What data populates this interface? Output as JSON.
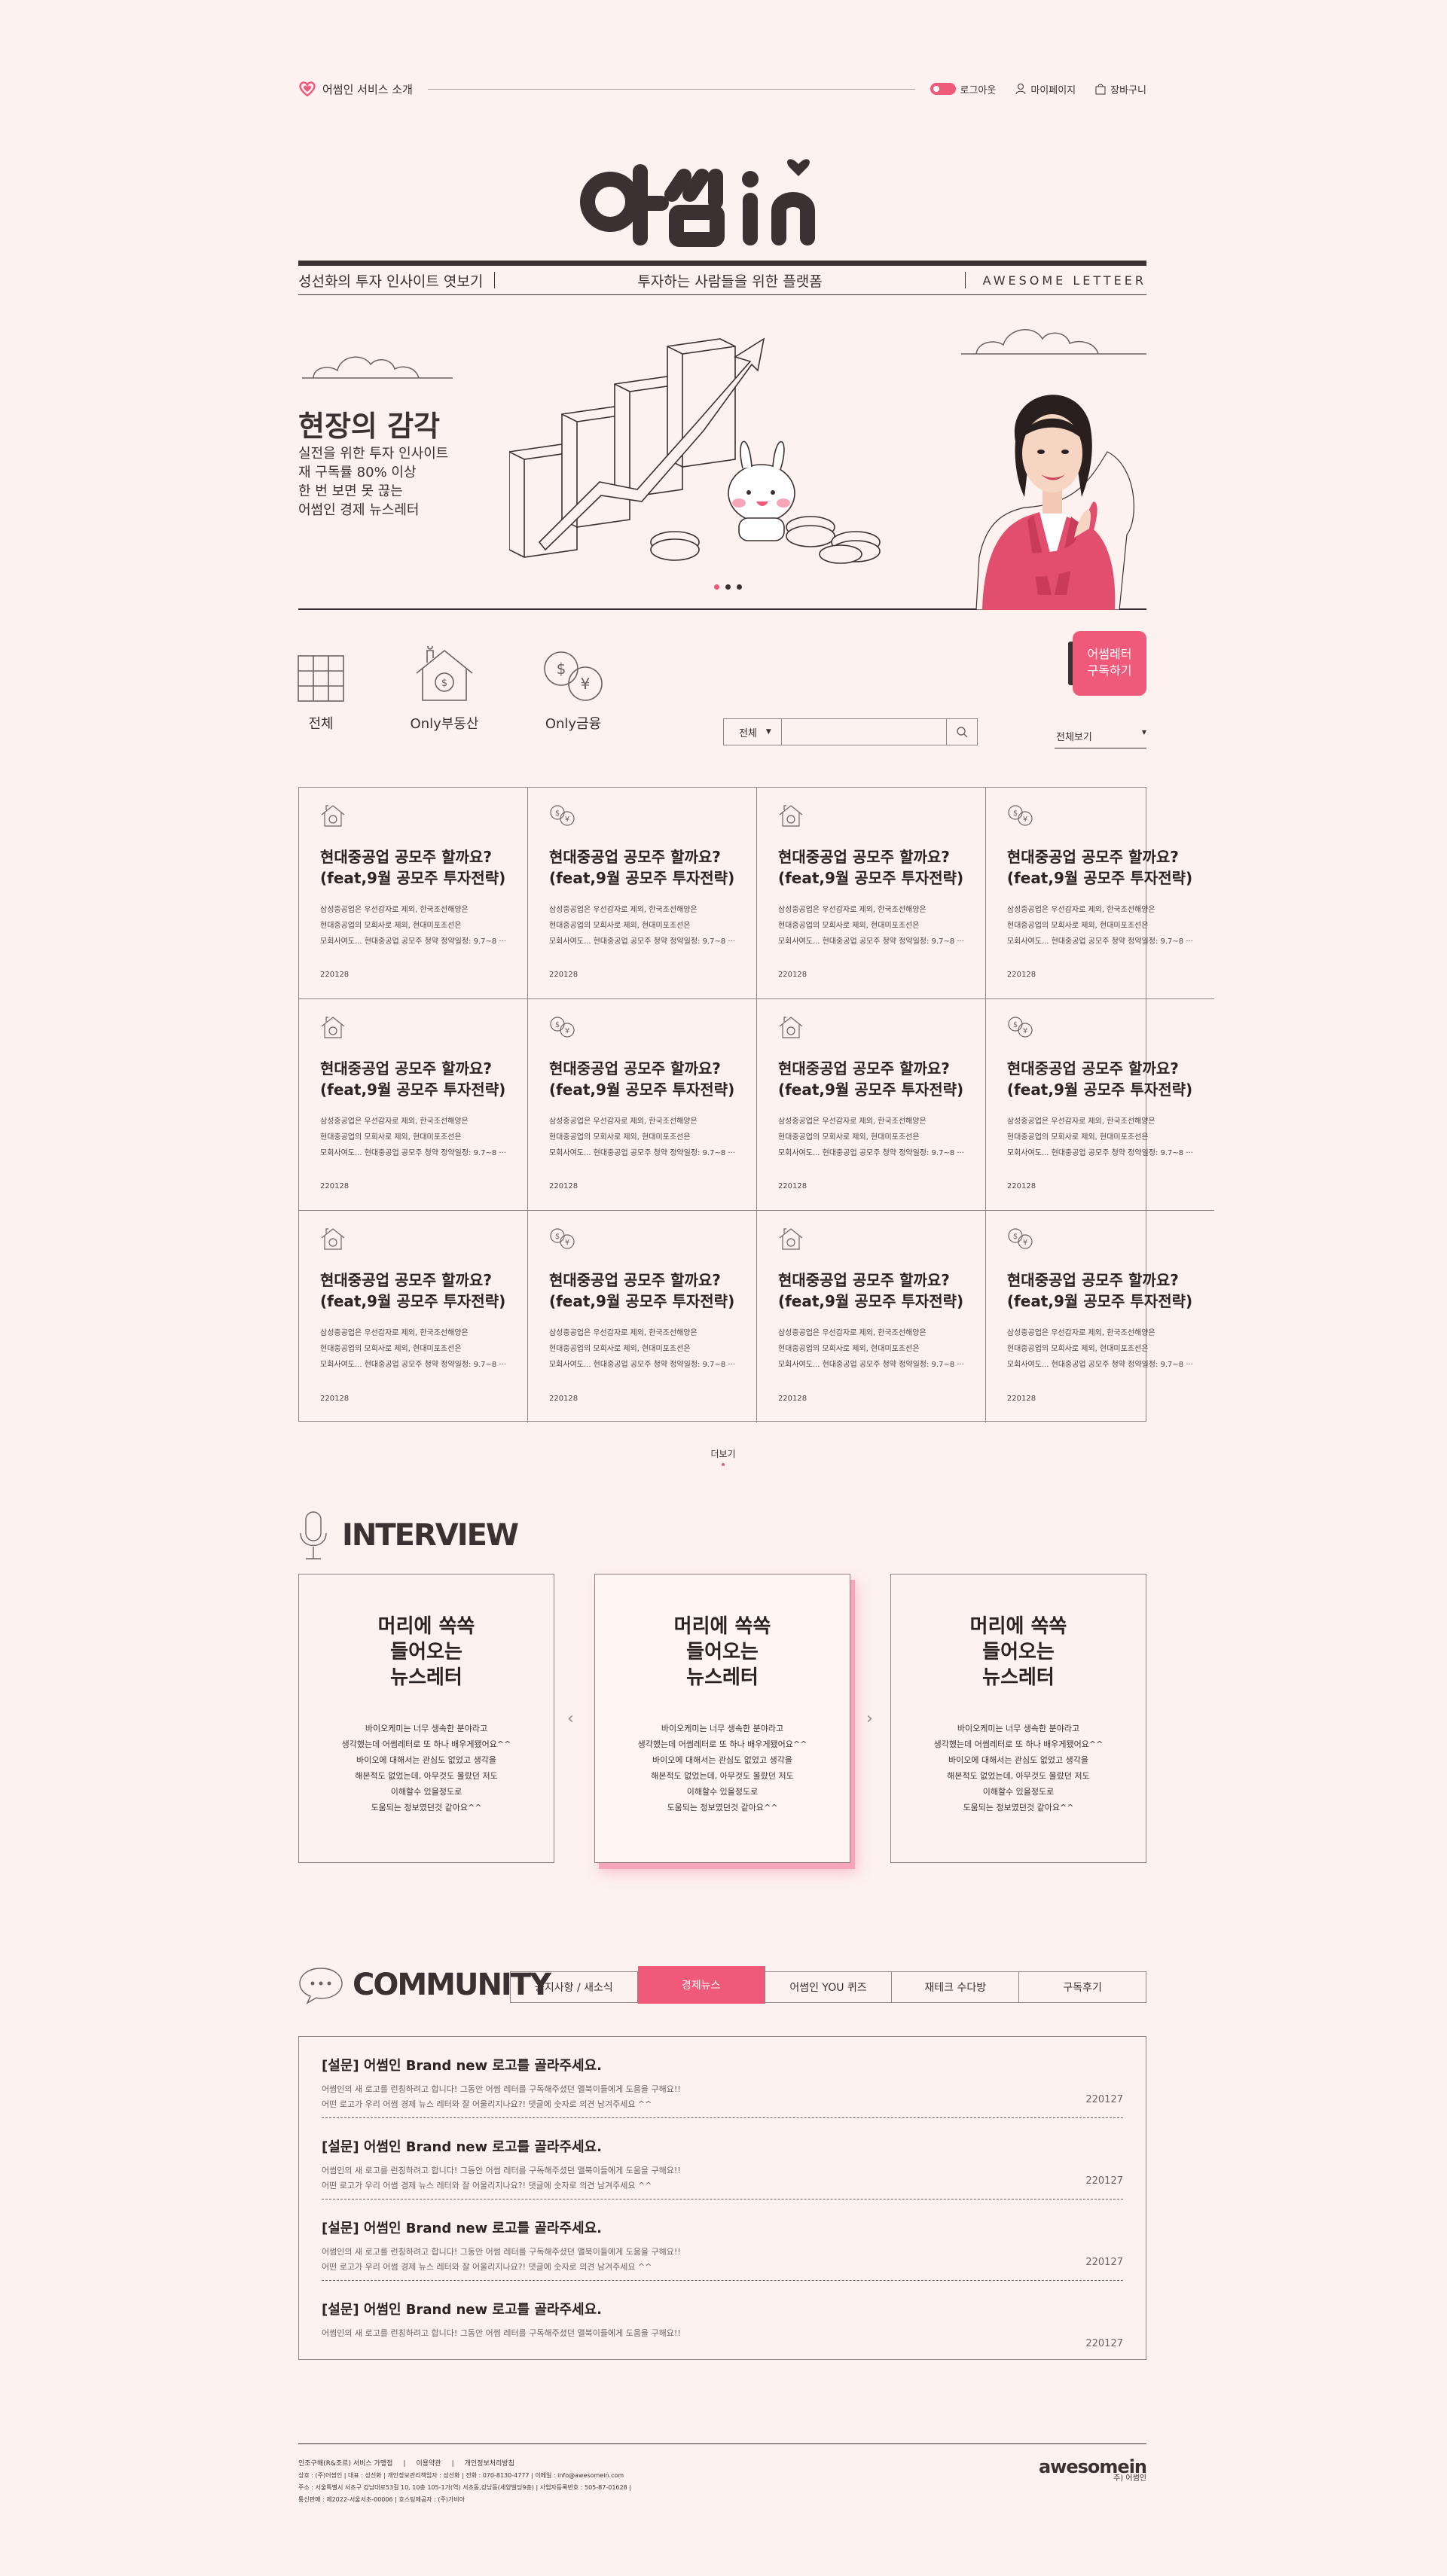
{
  "header": {
    "brand_label": "어썸인 서비스 소개",
    "logout": "로그아웃",
    "mypage": "마이페이지",
    "cart": "장바구니"
  },
  "logo_text": "어썸in",
  "navstrip": {
    "left": "성선화의 투자 인사이트 엿보기",
    "center": "투자하는 사람들을 위한 플랫폼",
    "right": "AWESOME LETTEER"
  },
  "hero": {
    "title": "현장의 감각",
    "lines": [
      "실전을 위한 투자 인사이트",
      "재 구독률 80% 이상",
      "한 번 보면 못 끊는",
      "어썸인 경제 뉴스레터"
    ]
  },
  "categories": [
    {
      "label": "전체",
      "icon": "grid-icon"
    },
    {
      "label": "Only부동산",
      "icon": "house-icon"
    },
    {
      "label": "Only금융",
      "icon": "coins-icon"
    }
  ],
  "subscribe": {
    "line1": "어썸레터",
    "line2": "구독하기"
  },
  "search": {
    "select": "전체"
  },
  "sort": {
    "label": "전체보기"
  },
  "cards": [
    {
      "icon": "house-icon",
      "title1": "현대중공업 공모주 할까요?",
      "title2": "(feat,9월 공모주 투자전략)",
      "d1": "삼성중공업은 우선감자로 제외, 한국조선해양은",
      "d2": "현대중공업의 모회사로 제외, 현대미포조선은",
      "d3": "모회사여도... 현대중공업 공모주 청약 정약일정: 9.7~8 ···",
      "date": "220128"
    },
    {
      "icon": "coins-icon",
      "title1": "현대중공업 공모주 할까요?",
      "title2": "(feat,9월 공모주 투자전략)",
      "d1": "삼성중공업은 우선감자로 제외, 한국조선해양은",
      "d2": "현대중공업의 모회사로 제외, 현대미포조선은",
      "d3": "모회사여도... 현대중공업 공모주 청약 정약일정: 9.7~8 ···",
      "date": "220128"
    },
    {
      "icon": "house-icon",
      "title1": "현대중공업 공모주 할까요?",
      "title2": "(feat,9월 공모주 투자전략)",
      "d1": "삼성중공업은 우선감자로 제외, 한국조선해양은",
      "d2": "현대중공업의 모회사로 제외, 현대미포조선은",
      "d3": "모회사여도... 현대중공업 공모주 청약 정약일정: 9.7~8 ···",
      "date": "220128"
    },
    {
      "icon": "coins-icon",
      "title1": "현대중공업 공모주 할까요?",
      "title2": "(feat,9월 공모주 투자전략)",
      "d1": "삼성중공업은 우선감자로 제외, 한국조선해양은",
      "d2": "현대중공업의 모회사로 제외, 현대미포조선은",
      "d3": "모회사여도... 현대중공업 공모주 청약 정약일정: 9.7~8 ···",
      "date": "220128"
    },
    {
      "icon": "house-icon",
      "title1": "현대중공업 공모주 할까요?",
      "title2": "(feat,9월 공모주 투자전략)",
      "d1": "삼성중공업은 우선감자로 제외, 한국조선해양은",
      "d2": "현대중공업의 모회사로 제외, 현대미포조선은",
      "d3": "모회사여도... 현대중공업 공모주 청약 정약일정: 9.7~8 ···",
      "date": "220128"
    },
    {
      "icon": "coins-icon",
      "title1": "현대중공업 공모주 할까요?",
      "title2": "(feat,9월 공모주 투자전략)",
      "d1": "삼성중공업은 우선감자로 제외, 한국조선해양은",
      "d2": "현대중공업의 모회사로 제외, 현대미포조선은",
      "d3": "모회사여도... 현대중공업 공모주 청약 정약일정: 9.7~8 ···",
      "date": "220128"
    },
    {
      "icon": "house-icon",
      "title1": "현대중공업 공모주 할까요?",
      "title2": "(feat,9월 공모주 투자전략)",
      "d1": "삼성중공업은 우선감자로 제외, 한국조선해양은",
      "d2": "현대중공업의 모회사로 제외, 현대미포조선은",
      "d3": "모회사여도... 현대중공업 공모주 청약 정약일정: 9.7~8 ···",
      "date": "220128"
    },
    {
      "icon": "coins-icon",
      "title1": "현대중공업 공모주 할까요?",
      "title2": "(feat,9월 공모주 투자전략)",
      "d1": "삼성중공업은 우선감자로 제외, 한국조선해양은",
      "d2": "현대중공업의 모회사로 제외, 현대미포조선은",
      "d3": "모회사여도... 현대중공업 공모주 청약 정약일정: 9.7~8 ···",
      "date": "220128"
    },
    {
      "icon": "house-icon",
      "title1": "현대중공업 공모주 할까요?",
      "title2": "(feat,9월 공모주 투자전략)",
      "d1": "삼성중공업은 우선감자로 제외, 한국조선해양은",
      "d2": "현대중공업의 모회사로 제외, 현대미포조선은",
      "d3": "모회사여도... 현대중공업 공모주 청약 정약일정: 9.7~8 ···",
      "date": "220128"
    },
    {
      "icon": "coins-icon",
      "title1": "현대중공업 공모주 할까요?",
      "title2": "(feat,9월 공모주 투자전략)",
      "d1": "삼성중공업은 우선감자로 제외, 한국조선해양은",
      "d2": "현대중공업의 모회사로 제외, 현대미포조선은",
      "d3": "모회사여도... 현대중공업 공모주 청약 정약일정: 9.7~8 ···",
      "date": "220128"
    },
    {
      "icon": "house-icon",
      "title1": "현대중공업 공모주 할까요?",
      "title2": "(feat,9월 공모주 투자전략)",
      "d1": "삼성중공업은 우선감자로 제외, 한국조선해양은",
      "d2": "현대중공업의 모회사로 제외, 현대미포조선은",
      "d3": "모회사여도... 현대중공업 공모주 청약 정약일정: 9.7~8 ···",
      "date": "220128"
    },
    {
      "icon": "coins-icon",
      "title1": "현대중공업 공모주 할까요?",
      "title2": "(feat,9월 공모주 투자전략)",
      "d1": "삼성중공업은 우선감자로 제외, 한국조선해양은",
      "d2": "현대중공업의 모회사로 제외, 현대미포조선은",
      "d3": "모회사여도... 현대중공업 공모주 청약 정약일정: 9.7~8 ···",
      "date": "220128"
    }
  ],
  "more_label": "더보기",
  "interview": {
    "title": "INTERVIEW",
    "cards": [
      {
        "h1": "머리에 쏙쏙",
        "h2": "들어오는",
        "h3": "뉴스레터",
        "p1": "바이오케미는 너무 생속한 분야라고",
        "p2": "생각했는데 어썸레터로 또 하나 배우게됐어요^^",
        "p3": "바이오에 대해서는 관심도 없었고 생각을",
        "p4": "해본적도 없었는데, 아무것도 몰랐던 저도",
        "p5": "이해할수 있을정도로",
        "p6": "도움되는 정보였던것 같아요^^"
      },
      {
        "h1": "머리에 쏙쏙",
        "h2": "들어오는",
        "h3": "뉴스레터",
        "p1": "바이오케미는 너무 생속한 분야라고",
        "p2": "생각했는데 어썸레터로 또 하나 배우게됐어요^^",
        "p3": "바이오에 대해서는 관심도 없었고 생각을",
        "p4": "해본적도 없었는데, 아무것도 몰랐던 저도",
        "p5": "이해할수 있을정도로",
        "p6": "도움되는 정보였던것 같아요^^"
      },
      {
        "h1": "머리에 쏙쏙",
        "h2": "들어오는",
        "h3": "뉴스레터",
        "p1": "바이오케미는 너무 생속한 분야라고",
        "p2": "생각했는데 어썸레터로 또 하나 배우게됐어요^^",
        "p3": "바이오에 대해서는 관심도 없었고 생각을",
        "p4": "해본적도 없었는데, 아무것도 몰랐던 저도",
        "p5": "이해할수 있을정도로",
        "p6": "도움되는 정보였던것 같아요^^"
      }
    ]
  },
  "community": {
    "title": "COMMUNITY",
    "tabs": [
      "공지사항 / 새소식",
      "경제뉴스",
      "어썸인 YOU 퀴즈",
      "재테크 수다방",
      "구독후기"
    ],
    "active_tab": "경제뉴스",
    "posts": [
      {
        "title": "[설문] 어썸인 Brand new 로고를 골라주세요.",
        "l1": "어썸인의 새 로고를 런칭하려고 합니다! 그동안 어썸 레터를 구독해주셨던 앨북이들에게 도움을 구해요!!",
        "l2": "어떤 로고가 우리 어썸 경제 뉴스 레터와 잘 어울리지나요?! 댓글에 숫자로 의견 남겨주세요 ^^",
        "date": "220127"
      },
      {
        "title": "[설문] 어썸인 Brand new 로고를 골라주세요.",
        "l1": "어썸인의 새 로고를 런칭하려고 합니다! 그동안 어썸 레터를 구독해주셨던 앨북이들에게 도움을 구해요!!",
        "l2": "어떤 로고가 우리 어썸 경제 뉴스 레터와 잘 어울리지나요?! 댓글에 숫자로 의견 남겨주세요 ^^",
        "date": "220127"
      },
      {
        "title": "[설문] 어썸인 Brand new 로고를 골라주세요.",
        "l1": "어썸인의 새 로고를 런칭하려고 합니다! 그동안 어썸 레터를 구독해주셨던 앨북이들에게 도움을 구해요!!",
        "l2": "어떤 로고가 우리 어썸 경제 뉴스 레터와 잘 어울리지나요?! 댓글에 숫자로 의견 남겨주세요 ^^",
        "date": "220127"
      },
      {
        "title": "[설문] 어썸인 Brand new 로고를 골라주세요.",
        "l1": "어썸인의 새 로고를 런칭하려고 합니다! 그동안 어썸 레터를 구독해주셨던 앨북이들에게 도움을 구해요!!",
        "l2": "",
        "date": "220127"
      }
    ]
  },
  "footer": {
    "links": [
      "인조구해(R&조르) 서비스 가맹점",
      "이용약관",
      "개인정보처리방침"
    ],
    "line1": "상호 : (주)어썸인 | 대표 : 성선화 | 개인정보관리책임자 : 성선화 | 전화 : 070-8130-4777 | 이메일 : info@awesomein.com",
    "line2": "주소 : 서울특별시 서초구 강남대로53길 10, 10층 105-1가(역) 서초동,강남동(세양빌딩9층) | 사업자등록번호 : 505-87-01628 |",
    "line3": "통신판매 : 제2022-서울서초-00006 | 호스팅제공자 : (주)가비아",
    "logo": "awesomein",
    "logo_sub": "주) 어썸인"
  },
  "colors": {
    "accent": "#ef5a7b",
    "ink": "#3c3132",
    "bg": "#fdf2ef"
  }
}
